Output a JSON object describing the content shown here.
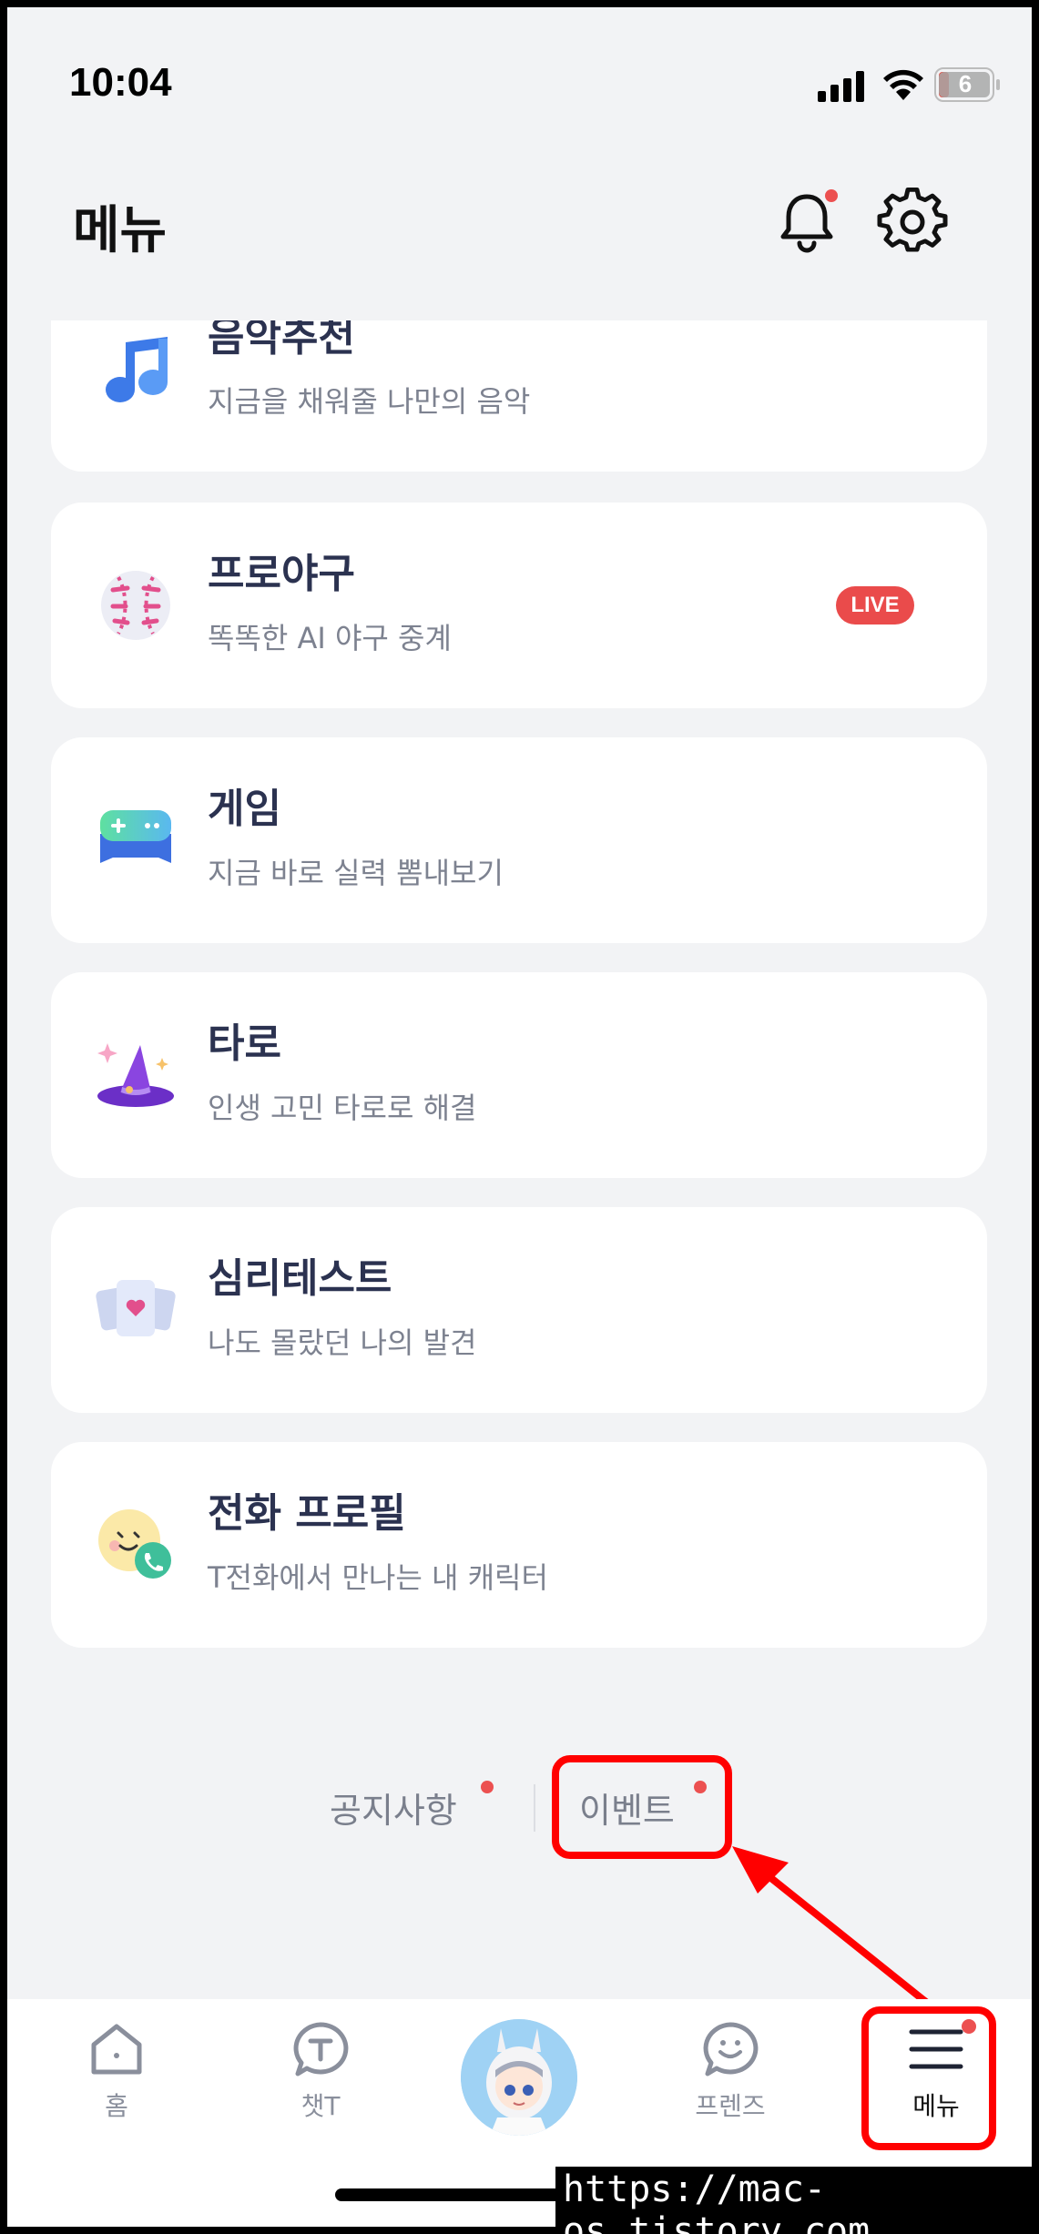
{
  "status_bar": {
    "time": "10:04",
    "battery": "6"
  },
  "header": {
    "title": "메뉴"
  },
  "cards": [
    {
      "id": "music",
      "title": "음악추천",
      "subtitle": "지금을 채워줄 나만의 음악",
      "icon": "music-note-icon"
    },
    {
      "id": "baseball",
      "title": "프로야구",
      "subtitle": "똑똑한 AI 야구 중계",
      "badge": "LIVE",
      "icon": "baseball-icon"
    },
    {
      "id": "game",
      "title": "게임",
      "subtitle": "지금 바로 실력 뽐내보기",
      "icon": "gamepad-icon"
    },
    {
      "id": "tarot",
      "title": "타로",
      "subtitle": "인생 고민 타로로 해결",
      "icon": "witch-hat-icon"
    },
    {
      "id": "psych",
      "title": "심리테스트",
      "subtitle": "나도 몰랐던 나의 발견",
      "icon": "cards-heart-icon"
    },
    {
      "id": "callprofile",
      "title": "전화 프로필",
      "subtitle": "T전화에서 만나는 내 캐릭터",
      "icon": "smiley-phone-icon"
    }
  ],
  "links": {
    "notice": "공지사항",
    "event": "이벤트"
  },
  "nav": {
    "home": "홈",
    "chat": "챗T",
    "friends": "프렌즈",
    "menu": "메뉴"
  },
  "watermark": "https://mac-os.tistory.com",
  "colors": {
    "accent_red": "#ec5050",
    "title": "#2b3250",
    "background": "#f2f3f5"
  }
}
